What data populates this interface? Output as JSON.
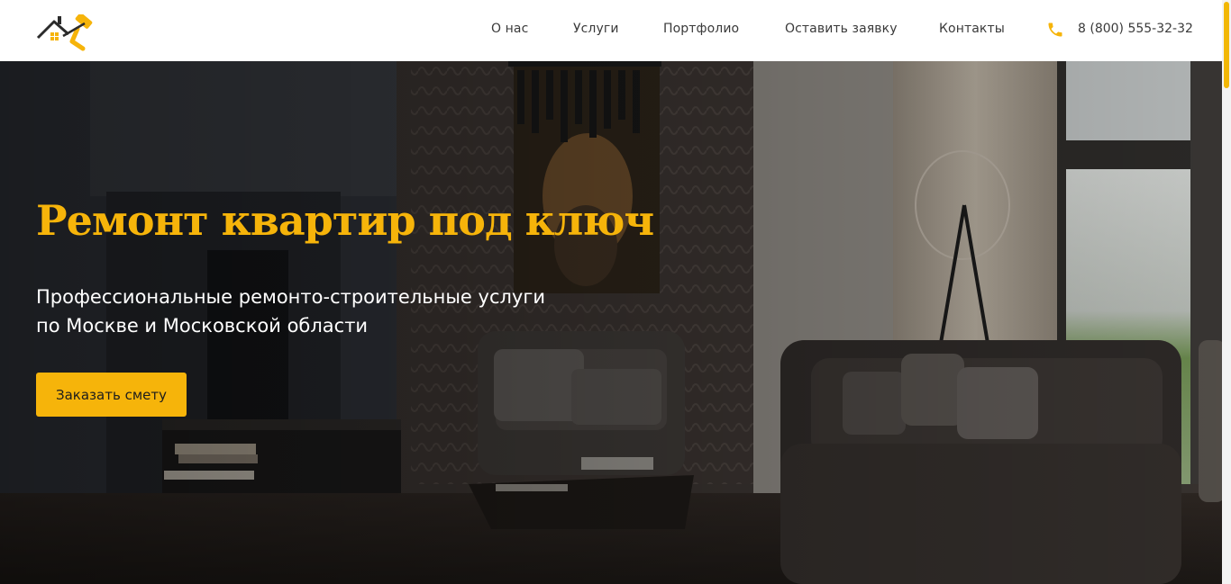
{
  "header": {
    "logo_alt": "",
    "nav": [
      {
        "label": "О нас"
      },
      {
        "label": "Услуги"
      },
      {
        "label": "Портфолио"
      },
      {
        "label": "Оставить заявку"
      },
      {
        "label": "Контакты"
      }
    ],
    "phone": "8 (800) 555-32-32"
  },
  "hero": {
    "title": "Ремонт квартир под ключ",
    "subtitle_line1": "Профессиональные ремонто-строительные услуги",
    "subtitle_line2": "по Москве и Московской области",
    "cta_label": "Заказать смету"
  },
  "colors": {
    "accent": "#f6b40a",
    "header_bg": "#ffffff",
    "nav_text": "#3a3a3a",
    "hero_text": "#ffffff"
  },
  "icons": {
    "logo": "house-roller-logo-icon",
    "phone": "phone-icon"
  }
}
